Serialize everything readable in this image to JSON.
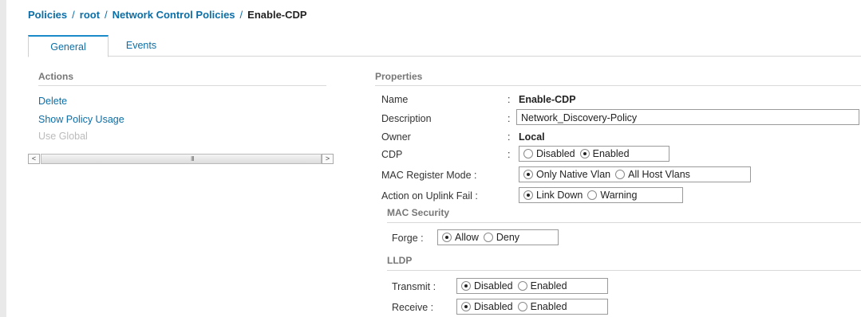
{
  "breadcrumb": {
    "items": [
      "Policies",
      "root",
      "Network Control Policies"
    ],
    "current": "Enable-CDP",
    "separator": "/"
  },
  "tabs": {
    "general": "General",
    "events": "Events"
  },
  "actions": {
    "title": "Actions",
    "delete": "Delete",
    "show_policy_usage": "Show Policy Usage",
    "use_global": "Use Global"
  },
  "scrollbar": {
    "left_arrow": "<",
    "right_arrow": ">",
    "grip": "III"
  },
  "properties": {
    "title": "Properties",
    "colon": ":",
    "name": {
      "label": "Name",
      "value": "Enable-CDP"
    },
    "description": {
      "label": "Description",
      "value": "Network_Discovery-Policy"
    },
    "owner": {
      "label": "Owner",
      "value": "Local"
    },
    "cdp": {
      "label": "CDP",
      "options": [
        "Disabled",
        "Enabled"
      ],
      "selected": "Enabled"
    },
    "mac_register_mode": {
      "label": "MAC Register Mode :",
      "options": [
        "Only Native Vlan",
        "All Host Vlans"
      ],
      "selected": "Only Native Vlan"
    },
    "action_on_uplink_fail": {
      "label": "Action on Uplink Fail :",
      "options": [
        "Link Down",
        "Warning"
      ],
      "selected": "Link Down"
    },
    "mac_security": {
      "title": "MAC Security",
      "forge": {
        "label": "Forge :",
        "options": [
          "Allow",
          "Deny"
        ],
        "selected": "Allow"
      }
    },
    "lldp": {
      "title": "LLDP",
      "transmit": {
        "label": "Transmit :",
        "options": [
          "Disabled",
          "Enabled"
        ],
        "selected": "Disabled"
      },
      "receive": {
        "label": "Receive :",
        "options": [
          "Disabled",
          "Enabled"
        ],
        "selected": "Disabled"
      }
    }
  },
  "colors": {
    "link": "#0c6ea6",
    "tab_accent": "#1a8ac8",
    "disabled_text": "#bbbbbb"
  }
}
